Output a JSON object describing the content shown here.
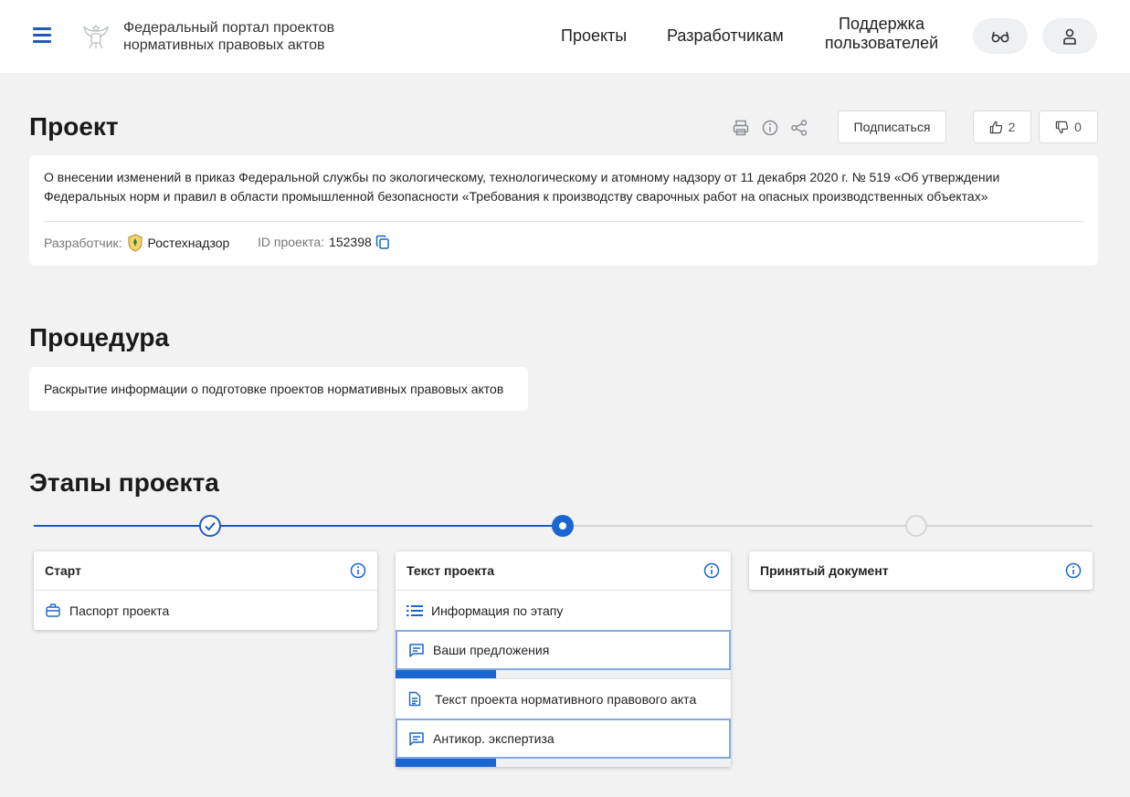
{
  "header": {
    "portal_name": "Федеральный портал проектов нормативных правовых актов",
    "nav": {
      "projects": "Проекты",
      "developers": "Разработчикам",
      "support": "Поддержка пользователей"
    }
  },
  "project": {
    "title": "Проект",
    "subscribe_label": "Подписаться",
    "likes": "2",
    "dislikes": "0",
    "description": "О внесении изменений в приказ Федеральной службы по экологическому, технологическому и атомному надзору от 11 декабря 2020 г. № 519 «Об утверждении Федеральных норм и правил в области промышленной безопасности «Требования к производству сварочных работ на опасных производственных объектах»",
    "developer_label": "Разработчик:",
    "developer": "Ростехнадзор",
    "id_label": "ID проекта:",
    "id": "152398"
  },
  "procedure": {
    "title": "Процедура",
    "text": "Раскрытие информации о подготовке проектов нормативных правовых актов"
  },
  "stages": {
    "title": "Этапы проекта",
    "items": [
      {
        "title": "Старт",
        "status": "done",
        "rows": [
          {
            "label": "Паспорт проекта",
            "icon": "briefcase-icon"
          }
        ]
      },
      {
        "title": "Текст проекта",
        "status": "current",
        "rows": [
          {
            "label": "Информация по этапу",
            "icon": "list-icon"
          },
          {
            "label": "Ваши предложения",
            "icon": "comment-icon",
            "progress": 0.3
          },
          {
            "label": "Текст проекта нормативного правового акта",
            "icon": "document-icon"
          },
          {
            "label": "Антикор. экспертиза",
            "icon": "comment-icon",
            "progress": 0.3
          }
        ]
      },
      {
        "title": "Принятый документ",
        "status": "pending",
        "rows": []
      }
    ]
  },
  "colors": {
    "accent": "#1a66d1",
    "highlight_border": "#86a9dd",
    "background": "#f2f2f2"
  }
}
